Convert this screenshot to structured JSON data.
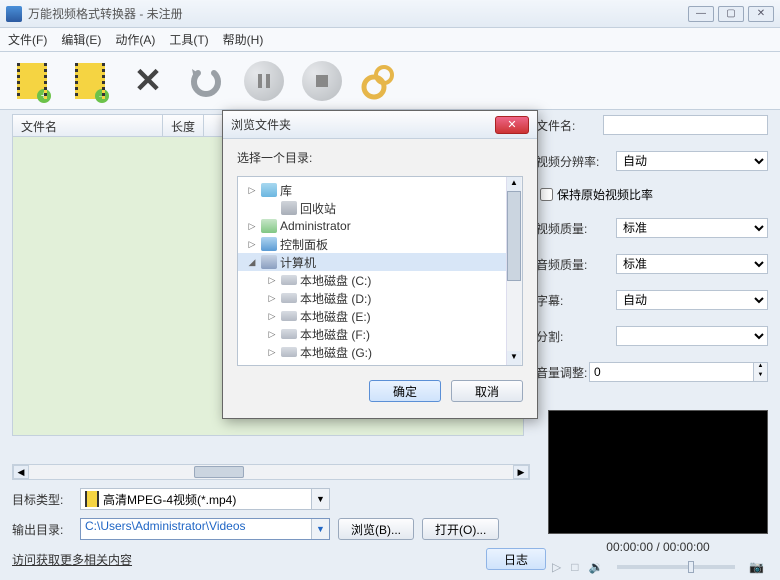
{
  "window": {
    "title": "万能视频格式转换器 - 未注册"
  },
  "menu": {
    "file": "文件(F)",
    "edit": "编辑(E)",
    "action": "动作(A)",
    "tools": "工具(T)",
    "help": "帮助(H)"
  },
  "table": {
    "col_filename": "文件名",
    "col_length": "长度"
  },
  "props": {
    "filename_label": "文件名:",
    "filename_value": "",
    "resolution_label": "视频分辨率:",
    "resolution_value": "自动",
    "keep_ratio_label": "保持原始视频比率",
    "video_quality_label": "视频质量:",
    "video_quality_value": "标准",
    "audio_quality_label": "音频质量:",
    "audio_quality_value": "标准",
    "subtitle_label": "字幕:",
    "subtitle_value": "自动",
    "split_label": "分割:",
    "split_value": "",
    "volume_label": "音量调整:",
    "volume_value": "0"
  },
  "bottom": {
    "target_type_label": "目标类型:",
    "target_type_value": "高清MPEG-4视频(*.mp4)",
    "output_dir_label": "输出目录:",
    "output_dir_value": "C:\\Users\\Administrator\\Videos",
    "browse_btn": "浏览(B)...",
    "open_btn": "打开(O)...",
    "more_link": "访问获取更多相关内容",
    "log_btn": "日志"
  },
  "preview": {
    "time": "00:00:00 / 00:00:00"
  },
  "dialog": {
    "title": "浏览文件夹",
    "instruction": "选择一个目录:",
    "ok": "确定",
    "cancel": "取消",
    "tree": [
      {
        "indent": 0,
        "toggle": "▷",
        "icon": "lib",
        "label": "库"
      },
      {
        "indent": 1,
        "toggle": "",
        "icon": "bin",
        "label": "回收站"
      },
      {
        "indent": 0,
        "toggle": "▷",
        "icon": "user",
        "label": "Administrator"
      },
      {
        "indent": 0,
        "toggle": "▷",
        "icon": "panel",
        "label": "控制面板"
      },
      {
        "indent": 0,
        "toggle": "◢",
        "icon": "computer",
        "label": "计算机",
        "selected": true
      },
      {
        "indent": 1,
        "toggle": "▷",
        "icon": "disk",
        "label": "本地磁盘 (C:)"
      },
      {
        "indent": 1,
        "toggle": "▷",
        "icon": "disk",
        "label": "本地磁盘 (D:)"
      },
      {
        "indent": 1,
        "toggle": "▷",
        "icon": "disk",
        "label": "本地磁盘 (E:)"
      },
      {
        "indent": 1,
        "toggle": "▷",
        "icon": "disk",
        "label": "本地磁盘 (F:)"
      },
      {
        "indent": 1,
        "toggle": "▷",
        "icon": "disk",
        "label": "本地磁盘 (G:)"
      }
    ]
  }
}
